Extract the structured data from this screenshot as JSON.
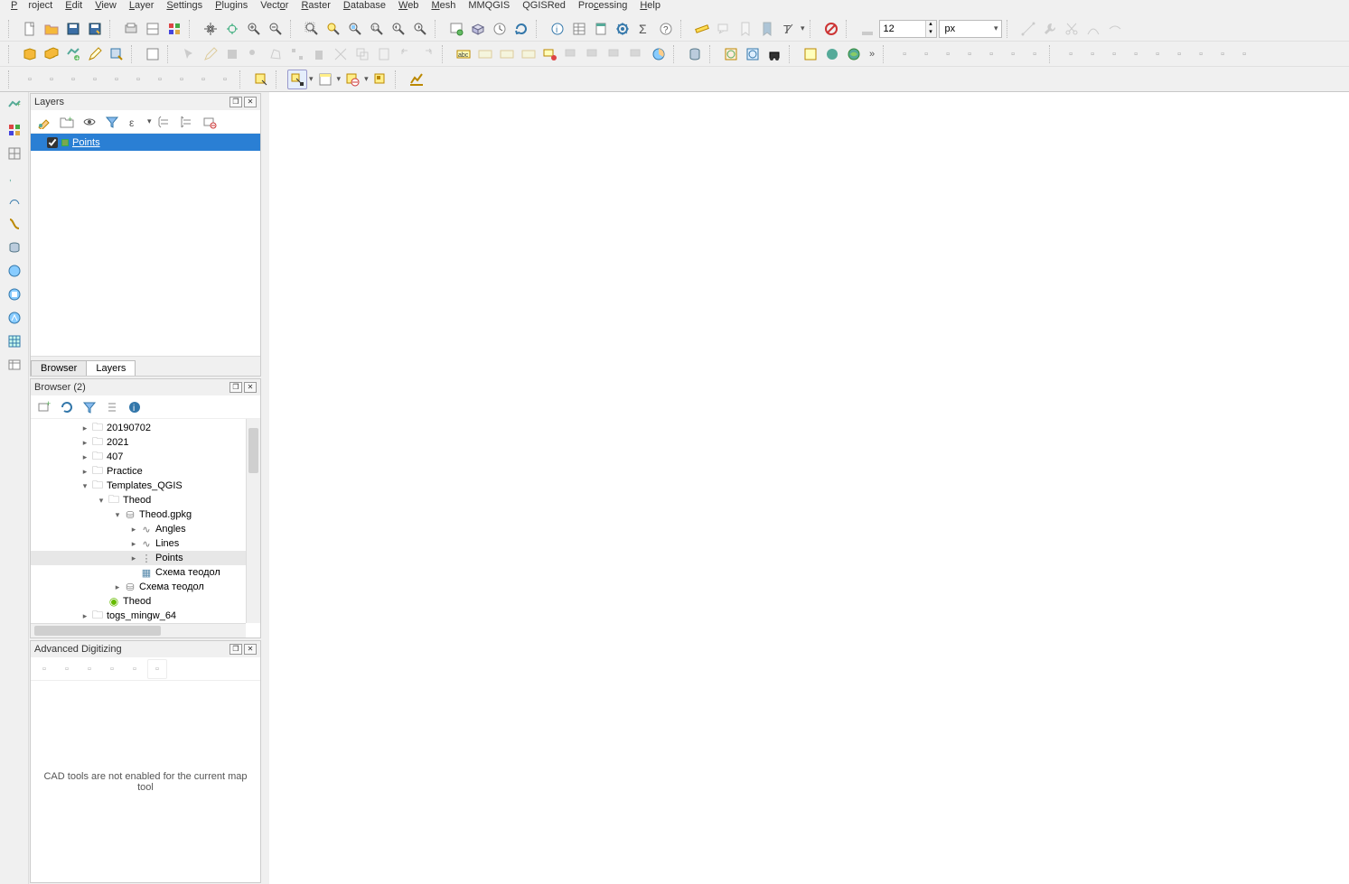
{
  "menu": {
    "items": [
      "Project",
      "Edit",
      "View",
      "Layer",
      "Settings",
      "Plugins",
      "Vector",
      "Raster",
      "Database",
      "Web",
      "Mesh",
      "MMQGIS",
      "QGISRed",
      "Processing",
      "Help"
    ]
  },
  "toolbar1": {
    "font_size": "12",
    "unit": "px"
  },
  "panels": {
    "layers": {
      "title": "Layers",
      "tabs": [
        "Browser",
        "Layers"
      ],
      "active_tab": 1,
      "items": [
        {
          "name": "Points",
          "checked": true,
          "selected": true
        }
      ]
    },
    "browser": {
      "title": "Browser (2)",
      "tree": [
        {
          "depth": 3,
          "twist": "▸",
          "icon": "folder",
          "label": "20190702"
        },
        {
          "depth": 3,
          "twist": "▸",
          "icon": "folder",
          "label": "2021"
        },
        {
          "depth": 3,
          "twist": "▸",
          "icon": "folder",
          "label": "407"
        },
        {
          "depth": 3,
          "twist": "▸",
          "icon": "folder",
          "label": "Practice"
        },
        {
          "depth": 3,
          "twist": "▾",
          "icon": "folder",
          "label": "Templates_QGIS"
        },
        {
          "depth": 4,
          "twist": "▾",
          "icon": "folder",
          "label": "Theod"
        },
        {
          "depth": 5,
          "twist": "▾",
          "icon": "db",
          "label": "Theod.gpkg"
        },
        {
          "depth": 6,
          "twist": "▸",
          "icon": "line",
          "label": "Angles"
        },
        {
          "depth": 6,
          "twist": "▸",
          "icon": "line",
          "label": "Lines"
        },
        {
          "depth": 6,
          "twist": "▸",
          "icon": "point",
          "label": "Points",
          "sel": true
        },
        {
          "depth": 6,
          "twist": "",
          "icon": "img",
          "label": "Схема теодол"
        },
        {
          "depth": 5,
          "twist": "▸",
          "icon": "db",
          "label": "Схема теодол"
        },
        {
          "depth": 4,
          "twist": "",
          "icon": "qgis",
          "label": "Theod"
        },
        {
          "depth": 3,
          "twist": "▸",
          "icon": "folder",
          "label": "togs_mingw_64"
        }
      ]
    },
    "adv": {
      "title": "Advanced Digitizing",
      "message": "CAD tools are not enabled for the current map tool"
    }
  }
}
